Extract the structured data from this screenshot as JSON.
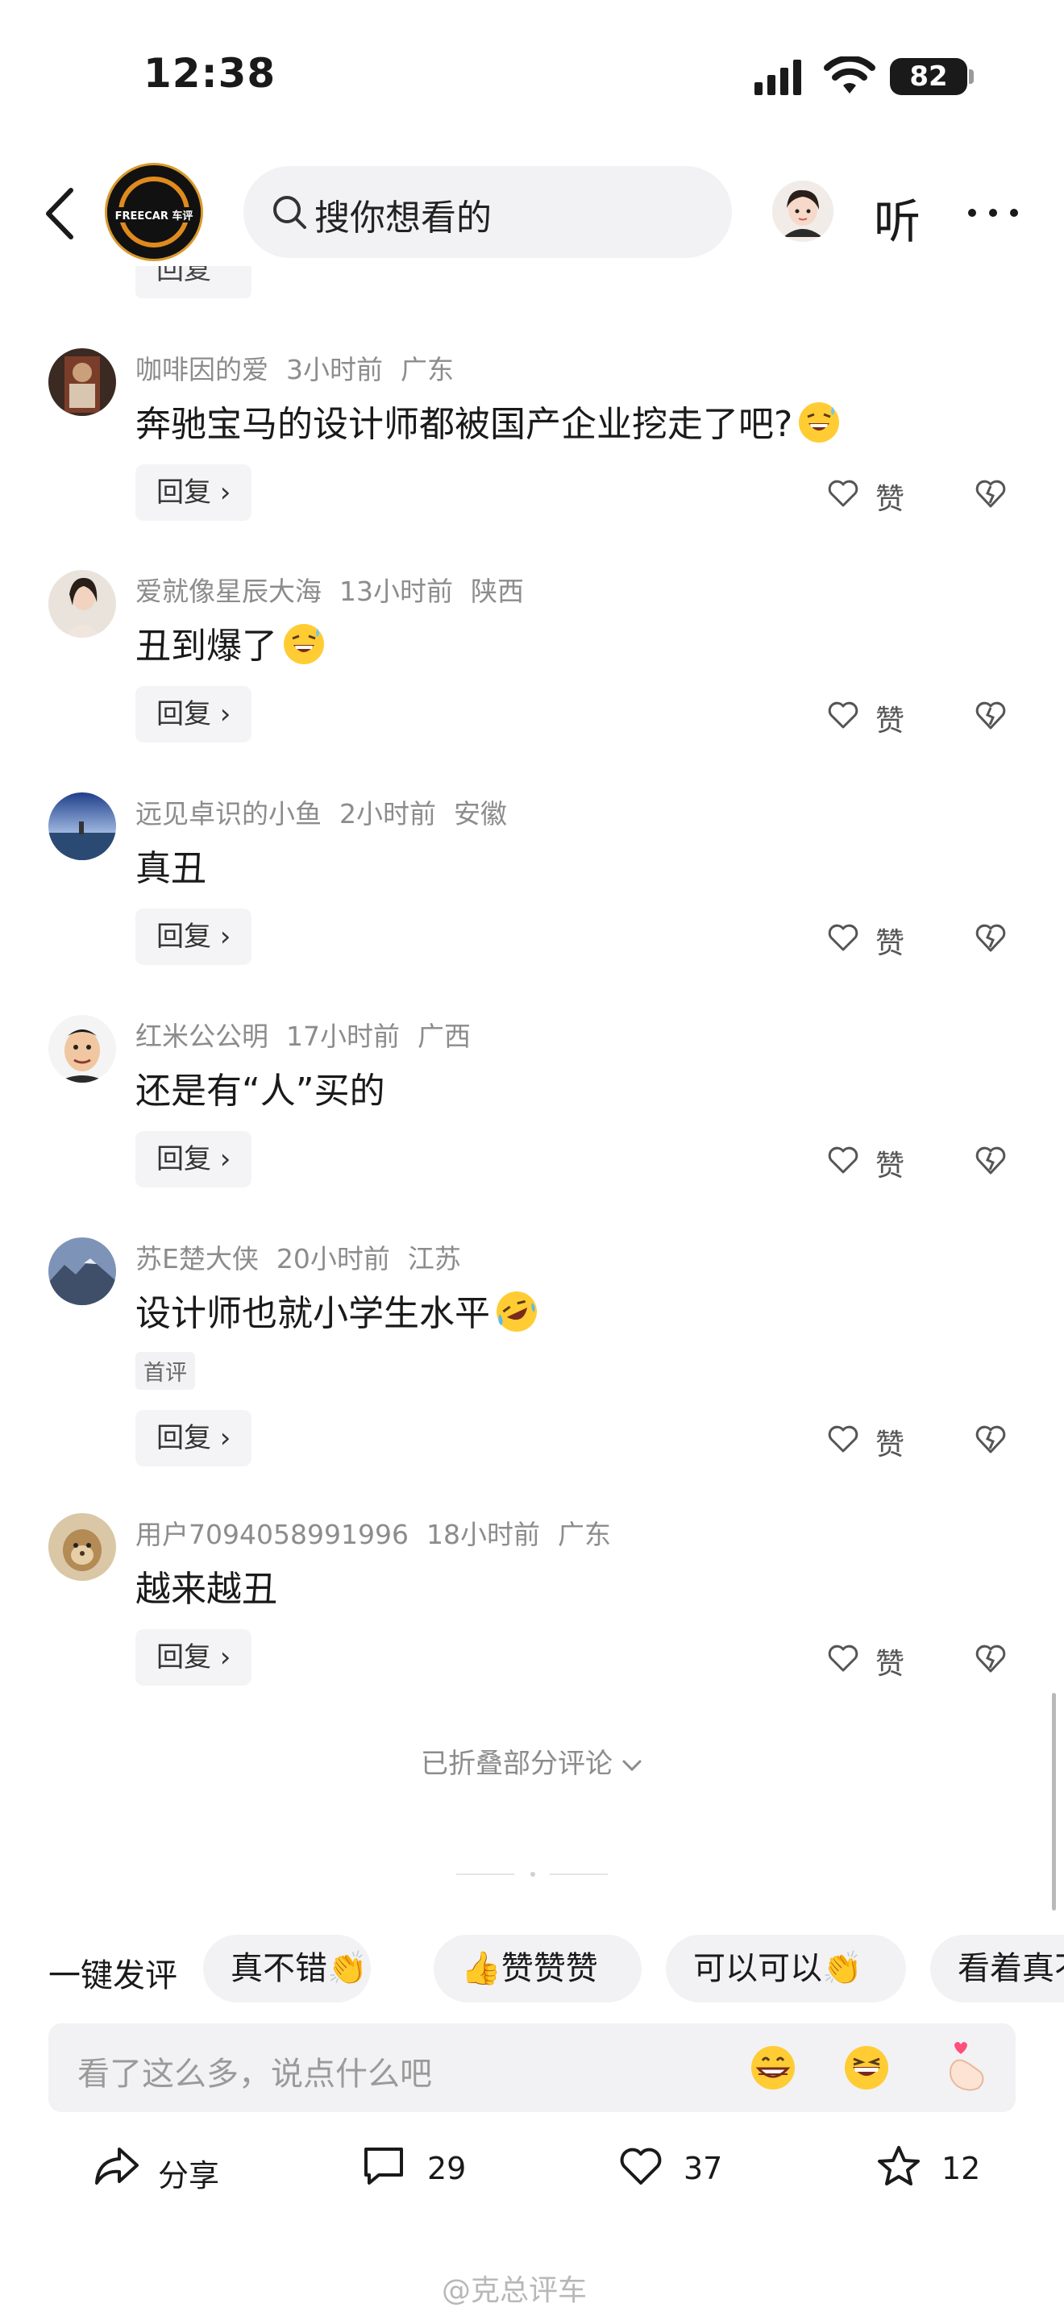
{
  "status_bar": {
    "time": "12:38",
    "battery": "82"
  },
  "header": {
    "search_placeholder": "搜你想看的",
    "listen_label": "听"
  },
  "peek_reply_label": "回复",
  "comments": [
    {
      "user": "咖啡因的爱",
      "time": "3小时前",
      "region": "广东",
      "text": "奔驰宝马的设计师都被国产企业挖走了吧?",
      "emoji": "grin-sweat",
      "reply_label": "回复",
      "like_label": "赞"
    },
    {
      "user": "爱就像星辰大海",
      "time": "13小时前",
      "region": "陕西",
      "text": "丑到爆了",
      "emoji": "grin-sweat",
      "reply_label": "回复",
      "like_label": "赞"
    },
    {
      "user": "远见卓识的小鱼",
      "time": "2小时前",
      "region": "安徽",
      "text": "真丑",
      "emoji": "",
      "reply_label": "回复",
      "like_label": "赞"
    },
    {
      "user": "红米公公明",
      "time": "17小时前",
      "region": "广西",
      "text": "还是有“人”买的",
      "emoji": "",
      "reply_label": "回复",
      "like_label": "赞"
    },
    {
      "user": "苏E楚大侠",
      "time": "20小时前",
      "region": "江苏",
      "text": "设计师也就小学生水平",
      "emoji": "rofl",
      "badge": "首评",
      "reply_label": "回复",
      "like_label": "赞"
    },
    {
      "user": "用户7094058991996",
      "time": "18小时前",
      "region": "广东",
      "text": "越来越丑",
      "emoji": "",
      "reply_label": "回复",
      "like_label": "赞"
    }
  ],
  "collapsed_label": "已折叠部分评论",
  "quick_comment": {
    "label": "一键发评",
    "chips": [
      "真不错👏",
      "👍赞赞赞",
      "可以可以👏",
      "看着真不"
    ]
  },
  "input": {
    "placeholder": "看了这么多，说点什么吧"
  },
  "bottom_bar": {
    "share_label": "分享",
    "comment_count": "29",
    "like_count": "37",
    "favorite_count": "12"
  },
  "watermark": "@克总评车",
  "colors": {
    "accent_logo": "#e08a1e",
    "muted_text": "#8c8c8c",
    "chip_bg": "#f2f2f4"
  }
}
